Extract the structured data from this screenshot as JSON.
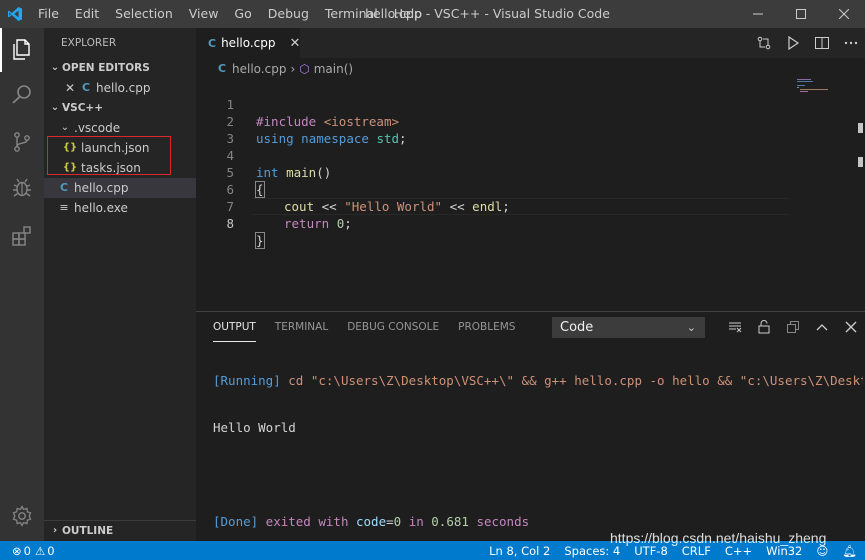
{
  "window": {
    "title": "hello.cpp - VSC++ - Visual Studio Code",
    "menu": [
      "File",
      "Edit",
      "Selection",
      "View",
      "Go",
      "Debug",
      "Terminal",
      "Help"
    ]
  },
  "sidebar": {
    "title": "EXPLORER",
    "open_editors": {
      "header": "OPEN EDITORS",
      "items": [
        {
          "name": "hello.cpp",
          "icon": "cpp-file-icon"
        }
      ]
    },
    "workspace": {
      "header": "VSC++",
      "tree": [
        {
          "name": ".vscode",
          "type": "folder",
          "expanded": true
        },
        {
          "name": "launch.json",
          "type": "json"
        },
        {
          "name": "tasks.json",
          "type": "json"
        },
        {
          "name": "hello.cpp",
          "type": "cpp",
          "selected": true
        },
        {
          "name": "hello.exe",
          "type": "exe"
        }
      ]
    },
    "outline_header": "OUTLINE"
  },
  "editor": {
    "tab": {
      "label": "hello.cpp",
      "close": "✕"
    },
    "breadcrumbs": [
      "hello.cpp",
      "main()"
    ],
    "lines": [
      {
        "n": "1",
        "text": "#include <iostream>"
      },
      {
        "n": "2",
        "text": "using namespace std;"
      },
      {
        "n": "3",
        "text": ""
      },
      {
        "n": "4",
        "text": "int main()"
      },
      {
        "n": "5",
        "text": "{"
      },
      {
        "n": "6",
        "text": "    cout << \"Hello World\" << endl;"
      },
      {
        "n": "7",
        "text": "    return 0;"
      },
      {
        "n": "8",
        "text": "}"
      }
    ],
    "tokens": {
      "l1_kw": "#include",
      "l1_inc": "<iostream>",
      "l2_kw1": "using",
      "l2_kw2": "namespace",
      "l2_ty": "std",
      "l2_semi": ";",
      "l4_kw": "int",
      "l4_fn": "main",
      "l4_par": "()",
      "l5": "{",
      "l6_a": "cout",
      "l6_b": " << ",
      "l6_str": "\"Hello World\"",
      "l6_c": " << ",
      "l6_d": "endl",
      "l6_e": ";",
      "l7_kw": "return",
      "l7_num": "0",
      "l7_semi": ";",
      "l8": "}"
    }
  },
  "panel": {
    "tabs": [
      "OUTPUT",
      "TERMINAL",
      "DEBUG CONSOLE",
      "PROBLEMS"
    ],
    "active_tab": "OUTPUT",
    "channel": "Code",
    "output": {
      "l1_tag": "[Running]",
      "l1_cmd": " cd \"c:\\Users\\Z\\Desktop\\VSC++\\\" && g++ hello.cpp -o hello && \"c:\\Users\\Z\\Desktop\\VSC++",
      "l2": "Hello World",
      "l3": "",
      "l4_tag": "[Done]",
      "l4_a": " exited with ",
      "l4_b": "code",
      "l4_c": "=",
      "l4_d": "0",
      "l4_e": " in ",
      "l4_f": "0.681",
      "l4_g": " seconds"
    }
  },
  "statusbar": {
    "errors": "0",
    "warnings": "0",
    "position": "Ln 8, Col 2",
    "spaces": "Spaces: 4",
    "encoding": "UTF-8",
    "eol": "CRLF",
    "language": "C++",
    "platform": "Win32"
  },
  "watermark": "https://blog.csdn.net/haishu_zheng",
  "colors": {
    "accent": "#007acc",
    "highlight_box": "#e0262d"
  }
}
